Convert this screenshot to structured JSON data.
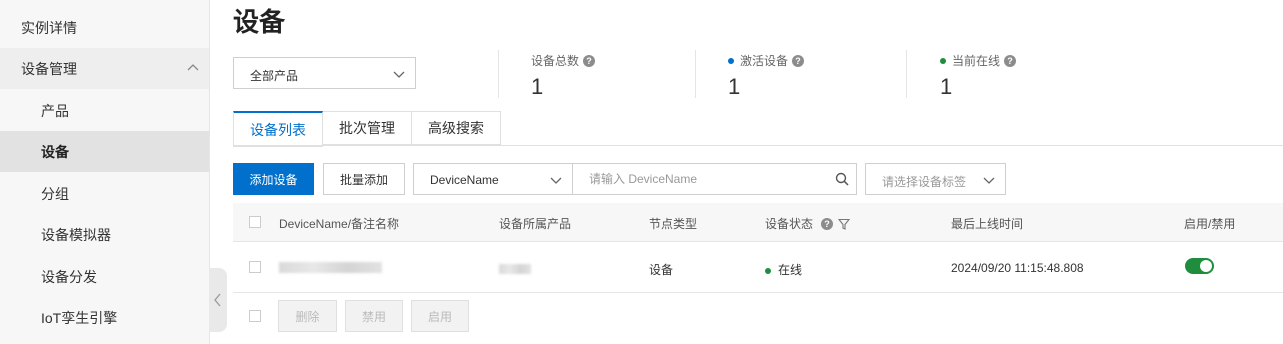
{
  "sidebar": {
    "items": [
      {
        "label": "实例详情"
      },
      {
        "label": "设备管理"
      },
      {
        "label": "产品"
      },
      {
        "label": "设备"
      },
      {
        "label": "分组"
      },
      {
        "label": "设备模拟器"
      },
      {
        "label": "设备分发"
      },
      {
        "label": "IoT孪生引擎"
      }
    ]
  },
  "page": {
    "title": "设备"
  },
  "filters": {
    "product_select": "全部产品",
    "field_select": "DeviceName",
    "search_placeholder": "请输入 DeviceName",
    "tag_placeholder": "请选择设备标签"
  },
  "stats": [
    {
      "label": "设备总数",
      "value": "1"
    },
    {
      "label": "激活设备",
      "value": "1",
      "dot_color": "#0070cc"
    },
    {
      "label": "当前在线",
      "value": "1",
      "dot_color": "#1e8e3e"
    }
  ],
  "tabs": [
    {
      "label": "设备列表"
    },
    {
      "label": "批次管理"
    },
    {
      "label": "高级搜索"
    }
  ],
  "actions": {
    "add": "添加设备",
    "batch_add": "批量添加"
  },
  "table": {
    "columns": [
      "DeviceName/备注名称",
      "设备所属产品",
      "节点类型",
      "设备状态",
      "最后上线时间",
      "启用/禁用"
    ],
    "rows": [
      {
        "node_type": "设备",
        "status": "在线",
        "last_online": "2024/09/20 11:15:48.808",
        "enabled": true
      }
    ]
  },
  "bulk": {
    "delete": "删除",
    "disable": "禁用",
    "enable": "启用"
  },
  "colors": {
    "primary": "#0070cc",
    "online": "#1e8e3e"
  }
}
